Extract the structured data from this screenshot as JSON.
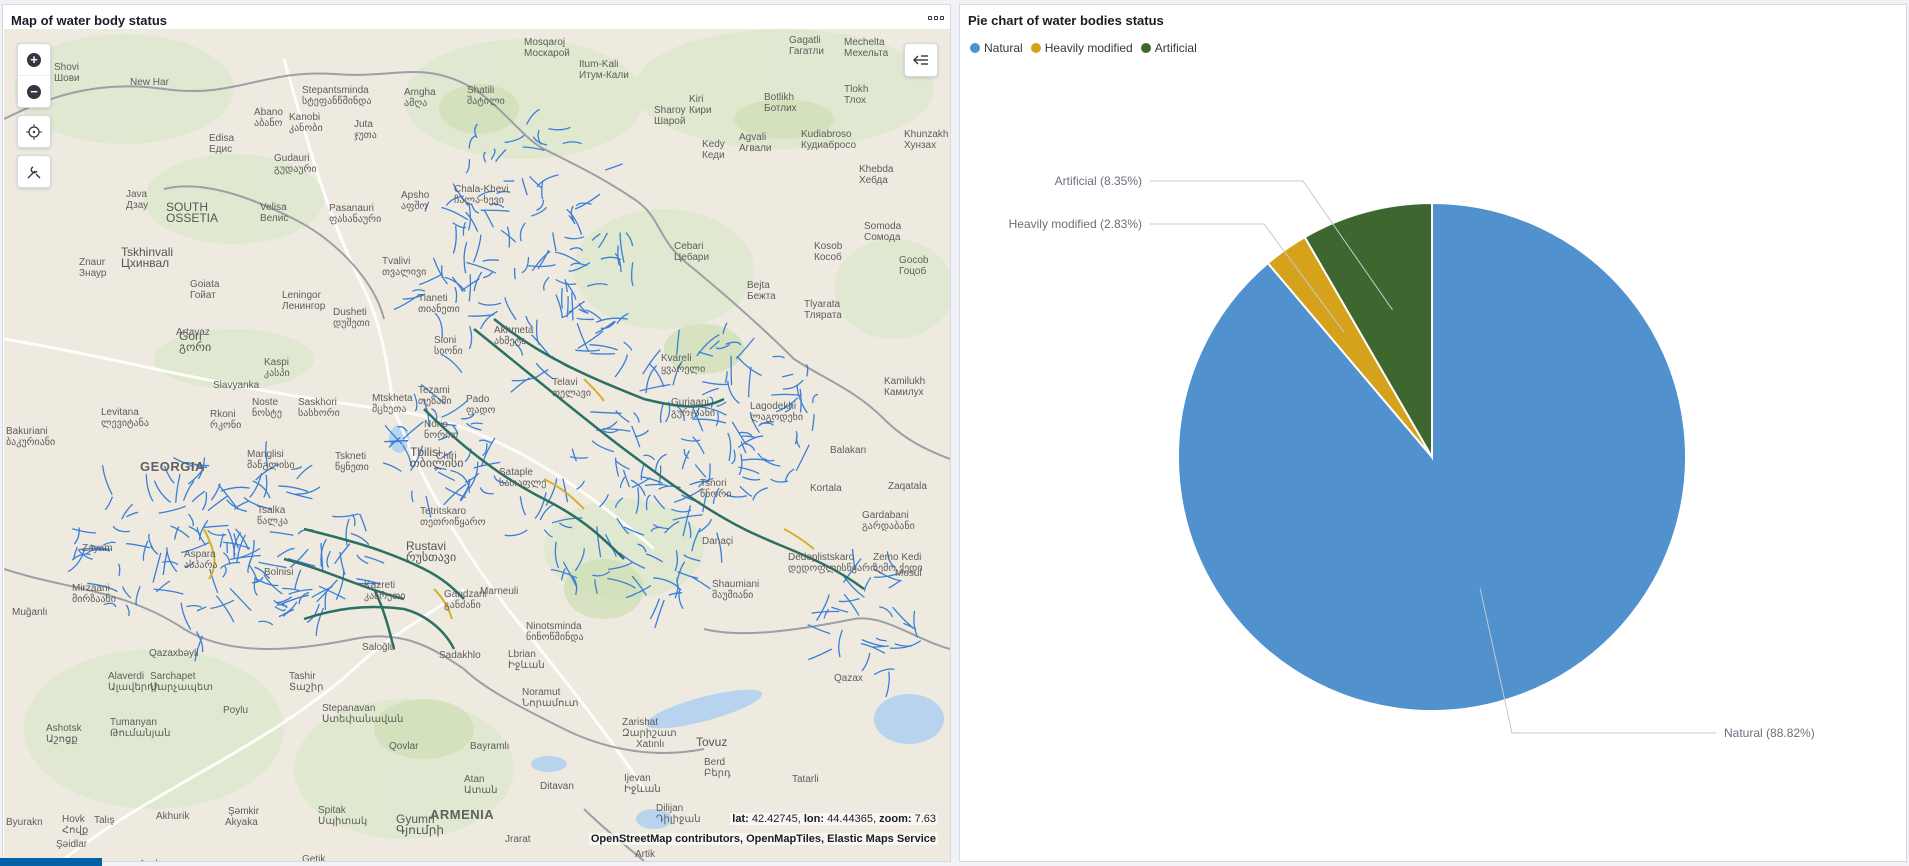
{
  "map_panel": {
    "title": "Map of water body status",
    "coords": {
      "lat_label": "lat:",
      "lat": "42.42745",
      "lon_label": "lon:",
      "lon": "44.44365",
      "zoom_label": "zoom:",
      "zoom": "7.63"
    },
    "attribution": "OpenStreetMap contributors, OpenMapTiles, Elastic Maps Service",
    "labels": [
      {
        "text": "Shovi",
        "s": "Шови"
      },
      {
        "text": "New Har",
        "s": ""
      },
      {
        "text": "Stepantsminda",
        "s": "სტეფანწმინდა"
      },
      {
        "text": "Abano",
        "s": "აბანო"
      },
      {
        "text": "Kanobi",
        "s": "კანობი"
      },
      {
        "text": "Juta",
        "s": "ჯუთა"
      },
      {
        "text": "Amgha",
        "s": "ამღა"
      },
      {
        "text": "Shatili",
        "s": "შატილი"
      },
      {
        "text": "Mosqaroj",
        "s": "Москарой"
      },
      {
        "text": "Itum-Kali",
        "s": "Итум-Кали"
      },
      {
        "text": "Gagatli",
        "s": "Гагатли"
      },
      {
        "text": "Mechelta",
        "s": "Мехельта"
      },
      {
        "text": "Kiri",
        "s": "Кири"
      },
      {
        "text": "Botlikh",
        "s": "Ботлих"
      },
      {
        "text": "Tlokh",
        "s": "Тлох"
      },
      {
        "text": "Sharoy",
        "s": "Шарой"
      },
      {
        "text": "Edisa",
        "s": "Едис"
      },
      {
        "text": "Gudauri",
        "s": "გუდაური"
      },
      {
        "text": "Kedy",
        "s": "Кеди"
      },
      {
        "text": "Agvali",
        "s": "Агвали"
      },
      {
        "text": "Kudiabroso",
        "s": "Кудиабросо"
      },
      {
        "text": "Khunzakh",
        "s": "Хунзах"
      },
      {
        "text": "Khebda",
        "s": "Хебда"
      },
      {
        "text": "Apsho",
        "s": "აფშო"
      },
      {
        "text": "Chala-Khevi",
        "s": "ჩალა-ხევი"
      },
      {
        "text": "Java",
        "s": "Дзау"
      },
      {
        "text": "SOUTH",
        "s": "OSSETIA"
      },
      {
        "text": "Velisa",
        "s": "Велис"
      },
      {
        "text": "Pasanauri",
        "s": "ფასანაური"
      },
      {
        "text": "Tskhinvali",
        "s": "Цхинвал"
      },
      {
        "text": "Znaur",
        "s": "Знаур"
      },
      {
        "text": "Goiata",
        "s": "Гойат"
      },
      {
        "text": "Leningor",
        "s": "Ленингор"
      },
      {
        "text": "Dusheti",
        "s": "დუშეთი"
      },
      {
        "text": "Tvalivi",
        "s": "თვალივი"
      },
      {
        "text": "Cebari",
        "s": "Цебари"
      },
      {
        "text": "Bejta",
        "s": "Бежта"
      },
      {
        "text": "Kosob",
        "s": "Кособ"
      },
      {
        "text": "Tlyarata",
        "s": "Тлярата"
      },
      {
        "text": "Somoda",
        "s": "Сомода"
      },
      {
        "text": "Gocob",
        "s": "Гоцоб"
      },
      {
        "text": "Gori",
        "s": "გორი"
      },
      {
        "text": "Kaspi",
        "s": "კასპი"
      },
      {
        "text": "Tianeti",
        "s": "თიანეთი"
      },
      {
        "text": "Akhmeta",
        "s": "ახმეტა"
      },
      {
        "text": "Sioni",
        "s": "სიონი"
      },
      {
        "text": "Telavi",
        "s": "თელავი"
      },
      {
        "text": "Kvareli",
        "s": "ყვარელი"
      },
      {
        "text": "Kamilukh",
        "s": "Камилух"
      },
      {
        "text": "Noste",
        "s": "ნოსტე"
      },
      {
        "text": "Saskhori",
        "s": "სასხორი"
      },
      {
        "text": "Mtskheta",
        "s": "მცხეთა"
      },
      {
        "text": "Tezami",
        "s": "თეზამი"
      },
      {
        "text": "Pado",
        "s": "ფადო"
      },
      {
        "text": "Norio",
        "s": "ნორიო"
      },
      {
        "text": "Gurjaani",
        "s": "გურჯაანი"
      },
      {
        "text": "Lagodekhi",
        "s": "ლაგოდეხი"
      },
      {
        "text": "Balakan",
        "s": ""
      },
      {
        "text": "Levitana",
        "s": "ლევიტანა"
      },
      {
        "text": "Rkoni",
        "s": "რკონი"
      },
      {
        "text": "Bakuriani",
        "s": "ბაკურიანი"
      },
      {
        "text": "GEORGIA",
        "s": ""
      },
      {
        "text": "Manglisi",
        "s": "მანგლისი"
      },
      {
        "text": "Tskneti",
        "s": "წყნეთი"
      },
      {
        "text": "Tbilisi",
        "s": "თბილისი"
      },
      {
        "text": "Chiri",
        "s": ""
      },
      {
        "text": "Sataple",
        "s": "სათაფლე"
      },
      {
        "text": "Tsnori",
        "s": "წნორი"
      },
      {
        "text": "Kortala",
        "s": ""
      },
      {
        "text": "Zaqatala",
        "s": ""
      },
      {
        "text": "Tsalka",
        "s": "წალკა"
      },
      {
        "text": "Tetritskaro",
        "s": "თეთრიწყარო"
      },
      {
        "text": "Rustavi",
        "s": "რუსთავი"
      },
      {
        "text": "Gardabani",
        "s": "გარდაბანი"
      },
      {
        "text": "Danaçi",
        "s": ""
      },
      {
        "text": "Dedoplistskaro",
        "s": "დედოფლისწყარო"
      },
      {
        "text": "Zemo Kedi",
        "s": "ზემო ქედი"
      },
      {
        "text": "Mosul",
        "s": ""
      },
      {
        "text": "Zayam",
        "s": ""
      },
      {
        "text": "Aspara",
        "s": "ასპარა"
      },
      {
        "text": "Bolnisi",
        "s": ""
      },
      {
        "text": "Kazreti",
        "s": "კაზრეთი"
      },
      {
        "text": "Shaumiani",
        "s": "შაუმიანი"
      },
      {
        "text": "Mirzaani",
        "s": "მირზაანი"
      },
      {
        "text": "Gandzani",
        "s": "განძანი"
      },
      {
        "text": "Marneuli",
        "s": ""
      },
      {
        "text": "Muğanlı",
        "s": ""
      },
      {
        "text": "Ninotsminda",
        "s": "ნინოწმინდა"
      },
      {
        "text": "Saloğlu",
        "s": ""
      },
      {
        "text": "Sadakhlo",
        "s": ""
      },
      {
        "text": "Lbrian",
        "s": "Իջևան"
      },
      {
        "text": "Qazaxbəyli",
        "s": ""
      },
      {
        "text": "Sarchapet",
        "s": "Սարչապետ"
      },
      {
        "text": "Tashir",
        "s": "Տաշիր"
      },
      {
        "text": "Alaverdi",
        "s": "Ալավերդի"
      },
      {
        "text": "Noramut",
        "s": "Նորամուտ"
      },
      {
        "text": "Qazax",
        "s": ""
      },
      {
        "text": "Poylu",
        "s": ""
      },
      {
        "text": "Stepanavan",
        "s": "Ստեփանավան"
      },
      {
        "text": "Tumanyan",
        "s": "Թումանյան"
      },
      {
        "text": "Ashotsk",
        "s": "Աշոցք"
      },
      {
        "text": "Zarishat",
        "s": "Զարիշատ"
      },
      {
        "text": "Xatınlı",
        "s": ""
      },
      {
        "text": "Tovuz",
        "s": ""
      },
      {
        "text": "Qovlar",
        "s": ""
      },
      {
        "text": "Bayramlı",
        "s": ""
      },
      {
        "text": "Atan",
        "s": "Ատան"
      },
      {
        "text": "Ditavan",
        "s": ""
      },
      {
        "text": "Ijevan",
        "s": "Իջևան"
      },
      {
        "text": "Berd",
        "s": "Բերդ"
      },
      {
        "text": "Tatarli",
        "s": ""
      },
      {
        "text": "Şəmkir",
        "s": ""
      },
      {
        "text": "Talış",
        "s": ""
      },
      {
        "text": "Spitak",
        "s": "Սպիտակ"
      },
      {
        "text": "Gyumri",
        "s": "Գյումրի"
      },
      {
        "text": "ARMENIA",
        "s": ""
      },
      {
        "text": "Dilijan",
        "s": "Դիլիջան"
      },
      {
        "text": "Hovk",
        "s": "Հովք"
      },
      {
        "text": "Şəidlar",
        "s": ""
      },
      {
        "text": "Byurakn",
        "s": ""
      },
      {
        "text": "Akhurik",
        "s": ""
      },
      {
        "text": "Akyaka",
        "s": ""
      },
      {
        "text": "Jrarat",
        "s": ""
      },
      {
        "text": "Avshen",
        "s": ""
      },
      {
        "text": "Getik",
        "s": ""
      },
      {
        "text": "Artik",
        "s": ""
      },
      {
        "text": "Artavaz",
        "s": ""
      },
      {
        "text": "Slavyanka",
        "s": ""
      }
    ]
  },
  "pie_panel": {
    "title": "Pie chart of water bodies status"
  },
  "chart_data": {
    "type": "pie",
    "title": "Pie chart of water bodies status",
    "legend_position": "top-left",
    "slices": [
      {
        "name": "Natural",
        "value": 88.82,
        "label": "Natural (88.82%)",
        "color": "#5191ce"
      },
      {
        "name": "Heavily modified",
        "value": 2.83,
        "label": "Heavily modified (2.83%)",
        "color": "#d6a21b"
      },
      {
        "name": "Artificial",
        "value": 8.35,
        "label": "Artificial (8.35%)",
        "color": "#3e6730"
      }
    ]
  }
}
